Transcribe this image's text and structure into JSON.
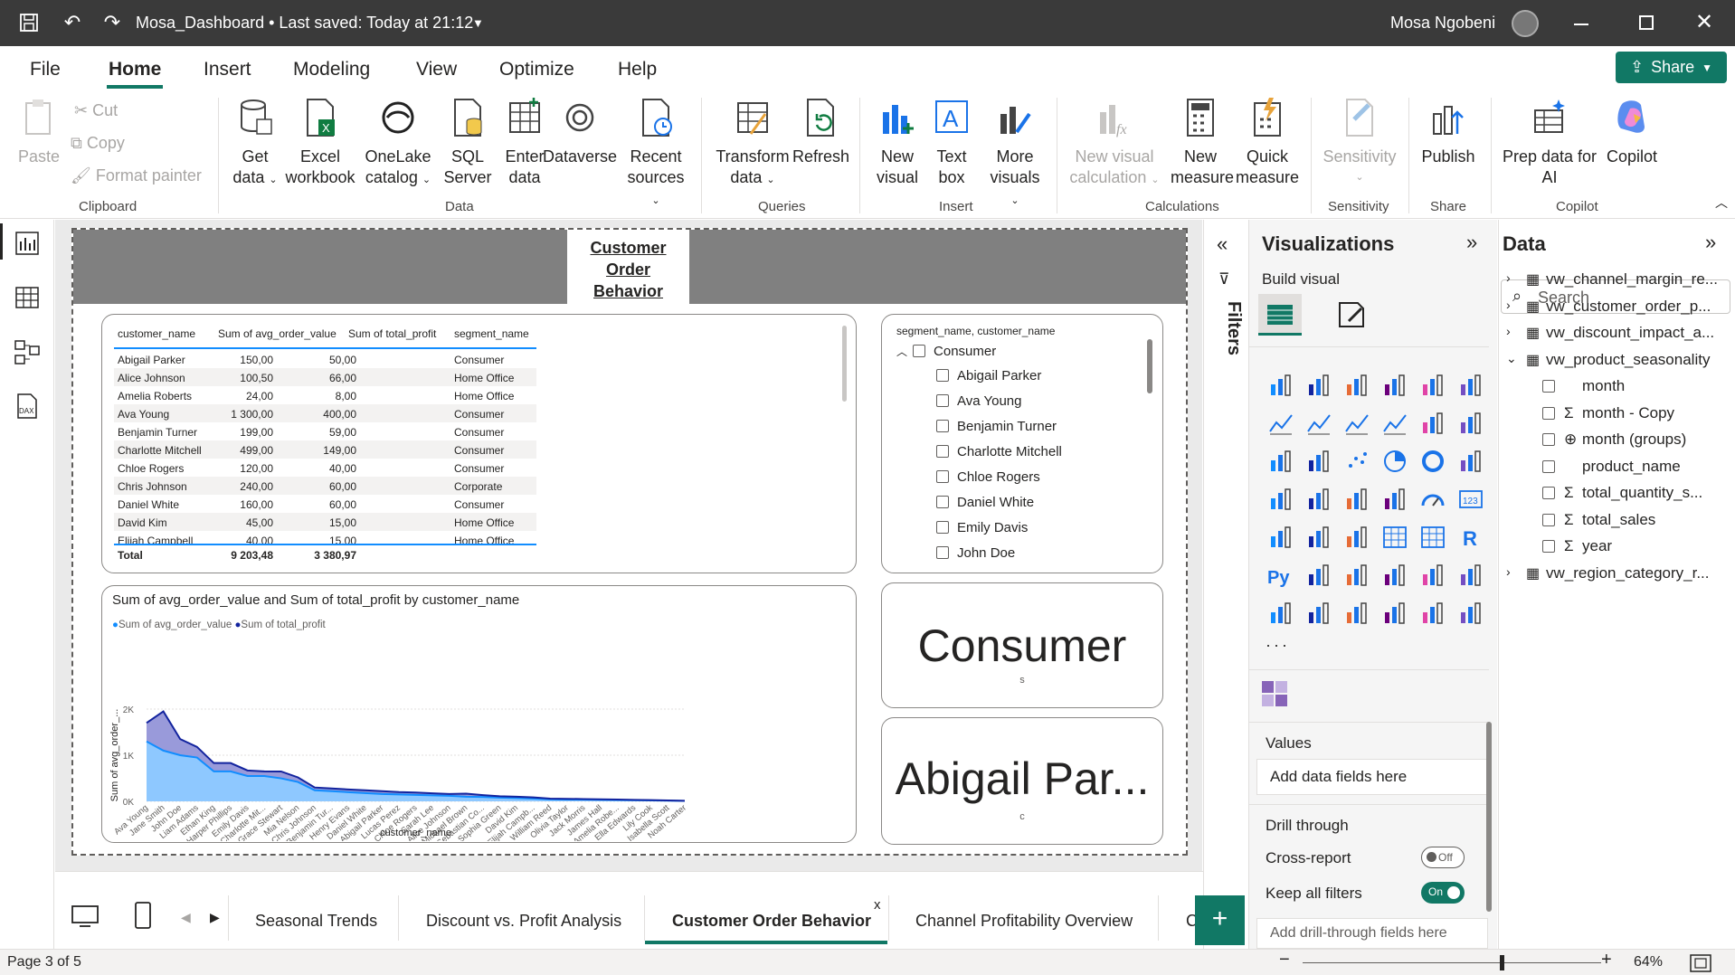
{
  "titlebar": {
    "title": "Mosa_Dashboard • Last saved: Today at 21:12",
    "user": "Mosa Ngobeni"
  },
  "menu": {
    "items": [
      "File",
      "Home",
      "Insert",
      "Modeling",
      "View",
      "Optimize",
      "Help"
    ],
    "share": "Share"
  },
  "ribbon": {
    "clipboard": {
      "paste": "Paste",
      "cut": "Cut",
      "copy": "Copy",
      "format_painter": "Format painter",
      "label": "Clipboard"
    },
    "data": {
      "get_data_1": "Get",
      "get_data_2": "data",
      "excel_1": "Excel",
      "excel_2": "workbook",
      "onelake_1": "OneLake",
      "onelake_2": "catalog",
      "sql_1": "SQL",
      "sql_2": "Server",
      "enter_1": "Enter",
      "enter_2": "data",
      "dataverse": "Dataverse",
      "recent_1": "Recent",
      "recent_2": "sources",
      "label": "Data"
    },
    "queries": {
      "transform_1": "Transform",
      "transform_2": "data",
      "refresh": "Refresh",
      "label": "Queries"
    },
    "insert": {
      "new_visual_1": "New",
      "new_visual_2": "visual",
      "text_box_1": "Text",
      "text_box_2": "box",
      "more_visuals_1": "More",
      "more_visuals_2": "visuals",
      "label": "Insert"
    },
    "calculations": {
      "nvc_1": "New visual",
      "nvc_2": "calculation",
      "new_measure_1": "New",
      "new_measure_2": "measure",
      "quick_measure_1": "Quick",
      "quick_measure_2": "measure",
      "label": "Calculations"
    },
    "sensitivity": {
      "sens": "Sensitivity",
      "label": "Sensitivity"
    },
    "share": {
      "publish": "Publish",
      "label": "Share"
    },
    "copilot": {
      "prep_1": "Prep data for",
      "prep_2": "AI",
      "copilot": "Copilot",
      "label": "Copilot"
    }
  },
  "report": {
    "title_1": "Customer",
    "title_2": "Order",
    "title_3": "Behavior"
  },
  "table": {
    "headers": [
      "customer_name",
      "Sum of avg_order_value",
      "Sum of total_profit",
      "segment_name"
    ],
    "rows": [
      [
        "Abigail Parker",
        "150,00",
        "50,00",
        "Consumer"
      ],
      [
        "Alice Johnson",
        "100,50",
        "66,00",
        "Home Office"
      ],
      [
        "Amelia Roberts",
        "24,00",
        "8,00",
        "Home Office"
      ],
      [
        "Ava Young",
        "1 300,00",
        "400,00",
        "Consumer"
      ],
      [
        "Benjamin Turner",
        "199,00",
        "59,00",
        "Consumer"
      ],
      [
        "Charlotte Mitchell",
        "499,00",
        "149,00",
        "Consumer"
      ],
      [
        "Chloe Rogers",
        "120,00",
        "40,00",
        "Consumer"
      ],
      [
        "Chris Johnson",
        "240,00",
        "60,00",
        "Corporate"
      ],
      [
        "Daniel White",
        "160,00",
        "60,00",
        "Consumer"
      ],
      [
        "David Kim",
        "45,00",
        "15,00",
        "Home Office"
      ],
      [
        "Elijah Campbell",
        "40,00",
        "15,00",
        "Home Office"
      ]
    ],
    "total": [
      "Total",
      "9 203,48",
      "3 380,97"
    ]
  },
  "slicer": {
    "header": "segment_name, customer_name",
    "group": "Consumer",
    "items": [
      "Abigail Parker",
      "Ava Young",
      "Benjamin Turner",
      "Charlotte Mitchell",
      "Chloe Rogers",
      "Daniel White",
      "Emily Davis",
      "John Doe"
    ]
  },
  "cards": {
    "card1_value": "Consumer",
    "card1_label": "s",
    "card2_value": "Abigail Par...",
    "card2_label": "c"
  },
  "chart_data": {
    "type": "area",
    "title": "Sum of avg_order_value and Sum of total_profit by customer_name",
    "xlabel": "customer_name",
    "ylabel": "Sum of avg_order_...",
    "y_ticks": [
      "2K",
      "1K",
      "0K"
    ],
    "ylim": [
      0,
      2000
    ],
    "categories": [
      "Ava Young",
      "Jane Smith",
      "John Doe",
      "Liam Adams",
      "Ethan King",
      "Harper Phillips",
      "Emily Davis",
      "Charlotte Mit...",
      "Grace Stewart",
      "Mia Nelson",
      "Chris Johnson",
      "Benjamin Tur...",
      "Henry Evans",
      "Daniel White",
      "Abigail Parker",
      "Lucas Perez",
      "Chloe Rogers",
      "Sarah Lee",
      "Alice Johnson",
      "Michael Brown",
      "Sebastian Co...",
      "Sophia Green",
      "David Kim",
      "Elijah Campb...",
      "William Reed",
      "Olivia Taylor",
      "Jack Morris",
      "James Hall",
      "Amelia Robe...",
      "Ella Edwards",
      "Lily Cook",
      "Isabella Scott",
      "Noah Carter"
    ],
    "series": [
      {
        "name": "Sum of avg_order_value",
        "color": "#118dff",
        "values": [
          1300,
          1100,
          1000,
          950,
          650,
          650,
          550,
          550,
          499,
          420,
          240,
          220,
          199,
          180,
          160,
          150,
          140,
          130,
          120,
          100.5,
          95,
          80,
          70,
          60,
          45,
          40,
          38,
          35,
          30,
          24,
          20,
          15,
          10
        ]
      },
      {
        "name": "Sum of total_profit",
        "color": "#12239e",
        "values": [
          400,
          850,
          350,
          230,
          180,
          180,
          120,
          100,
          149,
          100,
          60,
          60,
          59,
          60,
          60,
          50,
          50,
          45,
          40,
          66,
          40,
          30,
          30,
          25,
          15,
          15,
          12,
          10,
          10,
          8,
          6,
          5,
          3
        ]
      }
    ]
  },
  "filters": {
    "label": "Filters"
  },
  "viz": {
    "title": "Visualizations",
    "build": "Build visual",
    "values": "Values",
    "add_fields": "Add data fields here",
    "drill": "Drill through",
    "cross": "Cross-report",
    "cross_state": "Off",
    "keep": "Keep all filters",
    "keep_state": "On",
    "add_drill": "Add drill-through fields here"
  },
  "data_pane": {
    "title": "Data",
    "search_placeholder": "Search",
    "tables": [
      "vw_channel_margin_re...",
      "vw_customer_order_p...",
      "vw_discount_impact_a...",
      "vw_product_seasonality",
      "vw_region_category_r..."
    ],
    "fields": [
      "month",
      "month - Copy",
      "month (groups)",
      "product_name",
      "total_quantity_s...",
      "total_sales",
      "year"
    ]
  },
  "tabs": {
    "items": [
      "Seasonal Trends",
      "Discount vs. Profit Analysis",
      "Customer Order Behavior",
      "Channel Profitability Overview",
      "C"
    ],
    "close": "x"
  },
  "status": {
    "page": "Page 3 of 5",
    "zoom": "64%"
  }
}
